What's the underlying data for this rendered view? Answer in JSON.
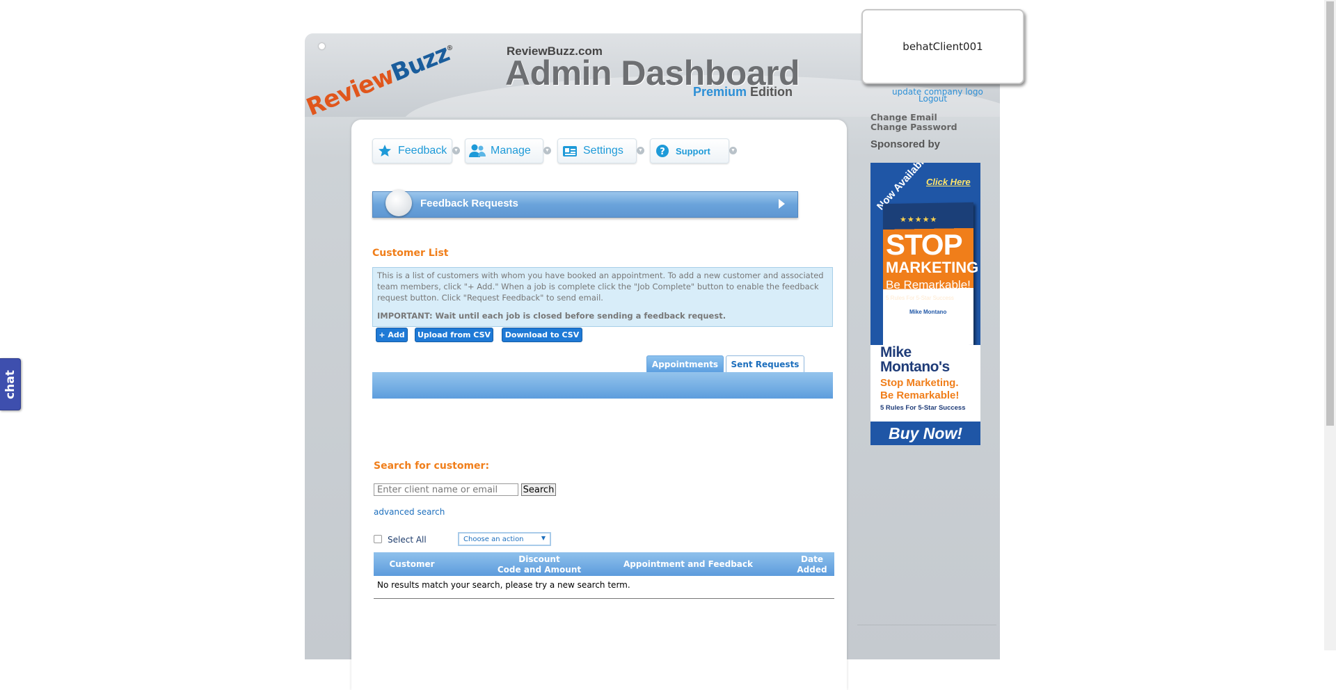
{
  "header": {
    "logo_review": "Review",
    "logo_buzz": "Buzz",
    "logo_reg": "®",
    "site_name": "ReviewBuzz.com",
    "title": "Admin Dashboard",
    "edition_premium": "Premium",
    "edition_label": "Edition"
  },
  "nav": {
    "feedback": "Feedback",
    "manage": "Manage",
    "settings": "Settings",
    "support": "Support"
  },
  "section_bar": "Feedback Requests",
  "customer_list": {
    "heading": "Customer List",
    "info": "This is a list of customers with whom you have booked an appointment. To add a new customer and associated team members, click \"+ Add.\" When a job is complete click the \"Job Complete\" button to enable the feedback request button. Click \"Request Feedback\" to send email.",
    "important": "IMPORTANT: Wait until each job is closed before sending a feedback request.",
    "add_btn": "+ Add",
    "upload_btn": "Upload from CSV",
    "download_btn": "Download to CSV"
  },
  "tabs": {
    "appointments": "Appointments",
    "sent_requests": "Sent Requests"
  },
  "search": {
    "heading": "Search for customer:",
    "placeholder": "Enter client name or email",
    "button": "Search",
    "advanced": "advanced search"
  },
  "bulk": {
    "select_all": "Select All",
    "action_placeholder": "Choose an action"
  },
  "results": {
    "columns": [
      "Customer",
      "Discount",
      "Code and Amount",
      "Appointment and Feedback",
      "Date",
      "Added"
    ],
    "empty": "No results match your search, please try a new search term."
  },
  "account": {
    "client": "behatClient001",
    "update_logo": "update company logo",
    "logout": "Logout",
    "change_email": "Change Email",
    "change_password": "Change Password",
    "sponsored_by": "Sponsored by"
  },
  "ad": {
    "now_available": "Now Available",
    "click_here": "Click Here",
    "stars": "★★★★★",
    "stop": "STOP",
    "marketing": "MARKETING",
    "be_remarkable": "Be Remarkable!",
    "rules_small": "5 Rules For 5-Star Success",
    "author_small": "Mike Montano",
    "author_line1": "Mike",
    "author_line2": "Montano's",
    "tag_line1": "Stop Marketing.",
    "tag_line2": "Be Remarkable!",
    "rules": "5 Rules For 5-Star Success",
    "buy_now": "Buy Now!"
  },
  "chat": "chat",
  "colors": {
    "accent_blue": "#1f7ad6",
    "heading_orange": "#f07e1a",
    "link_blue": "#2c8fd6"
  }
}
